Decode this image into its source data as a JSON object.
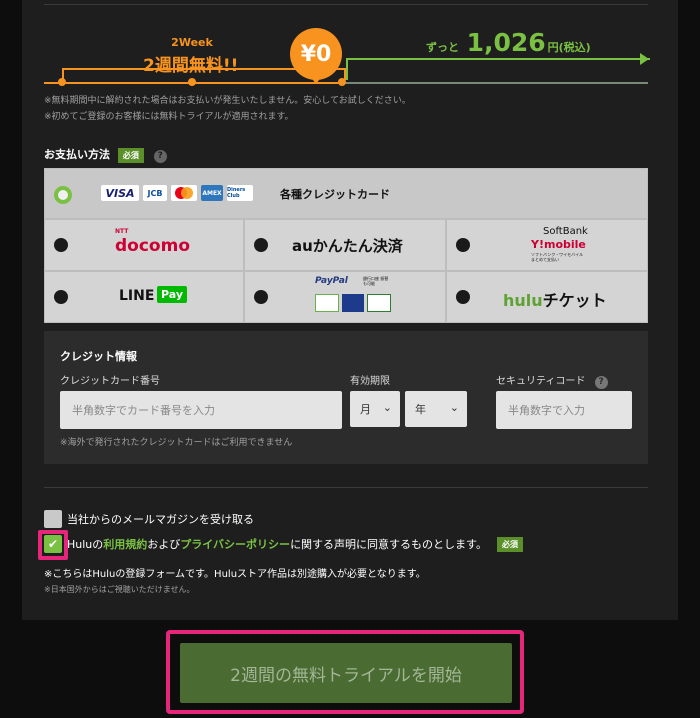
{
  "timeline": {
    "week_small": "2Week",
    "week_big": "2週間無料!!",
    "yen": "¥0",
    "price_prefix": "ずっと",
    "price_value": "1,026",
    "price_suffix": "円(税込)"
  },
  "notes": [
    "※無料期間中に解約された場合はお支払いが発生いたしません。安心してお試しください。",
    "※初めてご登録のお客様には無料トライアルが適用されます。"
  ],
  "payment": {
    "title": "お支払い方法",
    "required_badge": "必須",
    "help_icon": "?",
    "card_logos": [
      "VISA",
      "JCB",
      "MasterCard",
      "AMEX",
      "Diners Club"
    ],
    "options": {
      "credit": "各種クレジットカード",
      "docomo": "docomo",
      "docomo_small": "NTT",
      "au": "auかんたん決済",
      "softbank_top": "SoftBank",
      "softbank_mid": "Y!mobile",
      "softbank_sub": "ソフトバンク・ワイモバイル まとめて支払い",
      "line": "LINE",
      "line_pay": "Pay",
      "paypal": "PayPal",
      "paypal_sub": "銀行口座 振替も可能",
      "hulu_ticket_a": "hulu",
      "hulu_ticket_b": "チケット"
    }
  },
  "credit_info": {
    "title": "クレジット情報",
    "card_label": "クレジットカード番号",
    "card_placeholder": "半角数字でカード番号を入力",
    "expiry_label": "有効期限",
    "month": "月",
    "year": "年",
    "cvc_label": "セキュリティコード",
    "cvc_placeholder": "半角数字で入力",
    "note": "※海外で発行されたクレジットカードはご利用できません"
  },
  "consents": {
    "newsletter": "当社からのメールマガジンを受け取る",
    "terms_pre": "Huluの",
    "terms_link": "利用規約",
    "terms_mid": "および",
    "privacy_link": "プライバシーポリシー",
    "terms_post": "に関する声明に同意するものとします。",
    "required_badge": "必須",
    "check_mark": "✔"
  },
  "footnotes": {
    "store": "※こちらはHuluの登録フォームです。Huluストア作品は別途購入が必要となります。",
    "region": "※日本国外からはご視聴いただけません。"
  },
  "cta": {
    "label": "2週間の無料トライアルを開始"
  },
  "colors": {
    "accent_orange": "#f7931e",
    "hulu_green": "#7ac143",
    "highlight_pink": "#e6267a"
  }
}
